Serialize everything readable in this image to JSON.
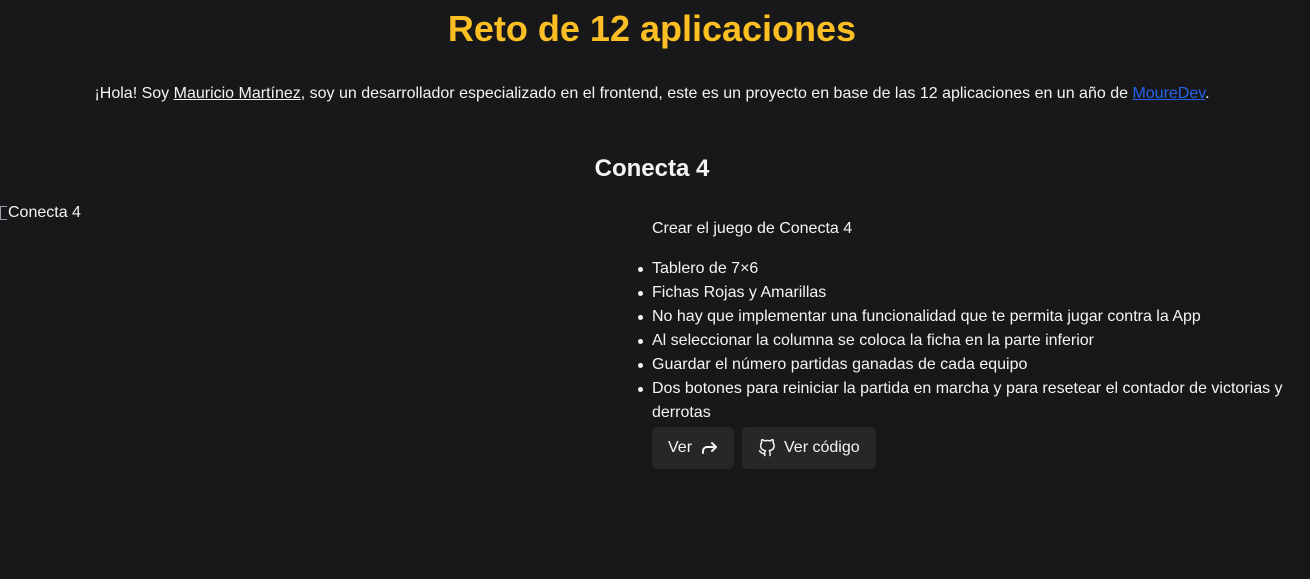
{
  "header": {
    "title": "Reto de 12 aplicaciones"
  },
  "intro": {
    "prefix": "¡Hola! Soy ",
    "author": "Mauricio Martínez",
    "middle": ", soy un desarrollador especializado en el frontend, este es un proyecto en base de las 12 aplicaciones en un año de ",
    "mouredev": "MoureDev",
    "suffix": ".",
    "colors": {
      "link": "#2563eb"
    }
  },
  "app": {
    "title": "Conecta 4",
    "image_alt": "Conecta 4",
    "description": "Crear el juego de Conecta 4",
    "requirements": [
      "Tablero de 7×6",
      "Fichas Rojas y Amarillas",
      "No hay que implementar una funcionalidad que te permita jugar contra la App",
      "Al seleccionar la columna se coloca la ficha en la parte inferior",
      "Guardar el número partidas ganadas de cada equipo",
      "Dos botones para reiniciar la partida en marcha y para resetear el contador de victorias y derrotas"
    ],
    "buttons": {
      "view_label": "Ver",
      "view_icon": "share-arrow-icon",
      "code_label": "Ver código",
      "code_icon": "github-icon"
    }
  },
  "theme": {
    "background": "#18181b",
    "accent": "#fbbf24",
    "button_bg": "#27272a"
  }
}
